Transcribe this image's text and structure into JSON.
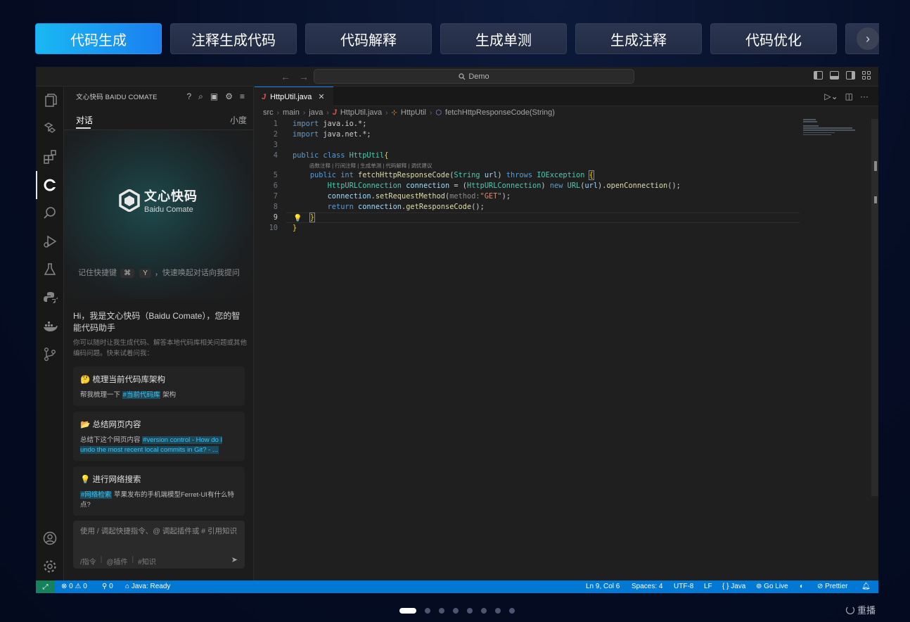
{
  "top_tabs": [
    "代码生成",
    "注释生成代码",
    "代码解释",
    "生成单测",
    "生成注释",
    "代码优化"
  ],
  "tabs_next_icon": "chevron-right-icon",
  "window": {
    "command_center": "Demo",
    "nav_back": "←",
    "nav_forward": "→"
  },
  "sidebar": {
    "header_title": "文心快码 BAIDU COMATE",
    "tab_chat": "对话",
    "tab_right": "小度",
    "logo_title": "文心快码",
    "logo_subtitle": "Baidu Comate",
    "hint_prefix": "记住快捷键",
    "hint_key1": "⌘",
    "hint_key2": "Y",
    "hint_suffix": "，快速唤起对话向我提问",
    "greeting": "Hi，我是文心快码（Baidu Comate），您的智能代码助手",
    "greeting_sub": "你可以随时让我生成代码、解答本地代码库相关问题或其他编码问题。快来试着问我：",
    "cards": [
      {
        "icon": "🤔",
        "title": "梳理当前代码库架构",
        "prefix": "帮我梳理一下",
        "tag": "#当前代码库",
        "suffix": "架构"
      },
      {
        "icon": "📂",
        "title": "总结网页内容",
        "prefix": "总结下这个网页内容",
        "tag": "#version control - How do I undo the most recent local commits in Git? - ...",
        "suffix": ""
      },
      {
        "icon": "💡",
        "title": "进行网络搜索",
        "prefix": "",
        "tag": "#网络检索",
        "suffix": "苹果发布的手机端模型Ferret-UI有什么特点?"
      }
    ],
    "input_placeholder": "使用 / 调起快捷指令、@ 调起插件或 # 引用知识",
    "input_tool1": "/指令",
    "input_tool2": "@插件",
    "input_tool3": "#知识"
  },
  "editor": {
    "tab_label": "HttpUtil.java",
    "tab_icon": "J",
    "breadcrumb": [
      "src",
      "main",
      "java",
      "HttpUtil.java",
      "HttpUtil",
      "fetchHttpResponseCode(String)"
    ],
    "code_lens": "函数注释 | 行间注释 | 生成单测 | 代码解释 | 调优建议",
    "line_numbers": [
      "1",
      "2",
      "3",
      "4",
      "5",
      "6",
      "7",
      "8",
      "9",
      "10"
    ],
    "method_hint": "method:"
  },
  "statusbar": {
    "errors": "0",
    "warnings": "0",
    "ports": "0",
    "java_status": "Java: Ready",
    "position": "Ln 9, Col 6",
    "spaces": "Spaces: 4",
    "encoding": "UTF-8",
    "eol": "LF",
    "language": "Java",
    "golive": "Go Live",
    "prettier": "Prettier"
  },
  "pager": {
    "count": 9,
    "active": 0
  },
  "replay_label": "重播",
  "colors": {
    "accent": "#1a7ff0",
    "status_bar": "#0078d4",
    "remote": "#16825d"
  }
}
